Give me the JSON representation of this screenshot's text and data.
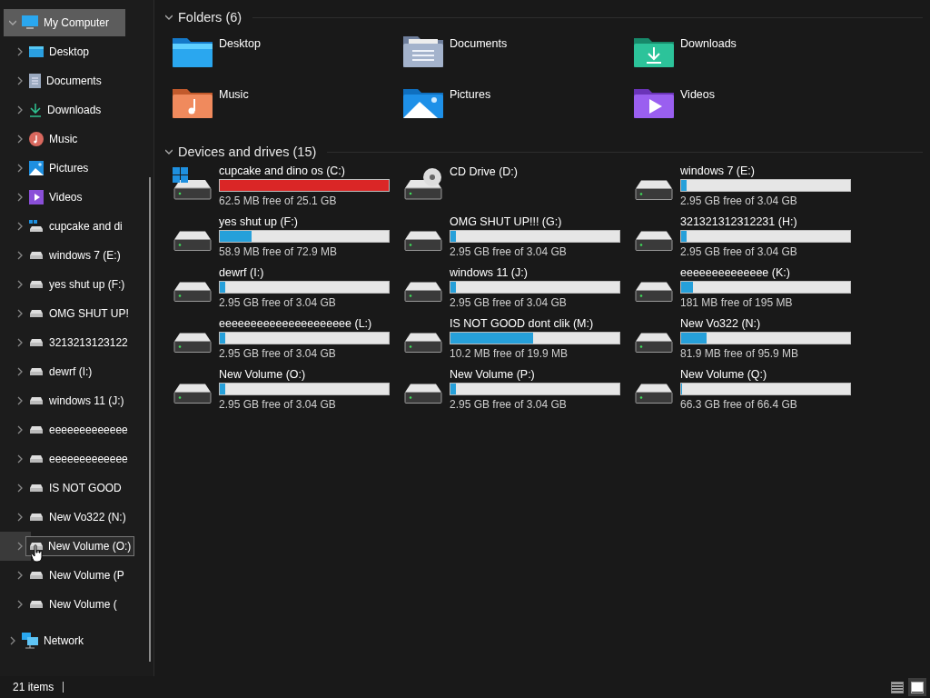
{
  "sidebar": {
    "root": {
      "label": "My Computer",
      "expanded": true,
      "selected": true,
      "children": [
        {
          "label": "Desktop",
          "kind": "desktop",
          "hovered": false
        },
        {
          "label": "Documents",
          "kind": "documents",
          "hovered": false
        },
        {
          "label": "Downloads",
          "kind": "downloads",
          "hovered": false
        },
        {
          "label": "Music",
          "kind": "music",
          "hovered": false
        },
        {
          "label": "Pictures",
          "kind": "pictures",
          "hovered": false
        },
        {
          "label": "Videos",
          "kind": "videos",
          "hovered": false
        },
        {
          "label": "cupcake and di",
          "kind": "system",
          "hovered": false
        },
        {
          "label": "windows 7 (E:)",
          "kind": "drive",
          "hovered": false
        },
        {
          "label": "yes shut up (F:)",
          "kind": "drive",
          "hovered": false
        },
        {
          "label": "OMG SHUT UP!",
          "kind": "drive",
          "hovered": false
        },
        {
          "label": "3213213123122",
          "kind": "drive",
          "hovered": false
        },
        {
          "label": "dewrf (I:)",
          "kind": "drive",
          "hovered": false
        },
        {
          "label": "windows 11 (J:)",
          "kind": "drive",
          "hovered": false
        },
        {
          "label": "eeeeeeeeeeeee",
          "kind": "drive",
          "hovered": false
        },
        {
          "label": "eeeeeeeeeeeee",
          "kind": "drive",
          "hovered": false
        },
        {
          "label": "IS NOT GOOD",
          "kind": "drive",
          "hovered": false
        },
        {
          "label": "New Vo322 (N:)",
          "kind": "drive",
          "hovered": false
        },
        {
          "label": "New Volume (O:)",
          "kind": "drive",
          "hovered": true
        },
        {
          "label": "New Volume (P",
          "kind": "drive",
          "hovered": false
        },
        {
          "label": "New Volume (",
          "kind": "drive",
          "hovered": false
        }
      ]
    },
    "network": {
      "label": "Network",
      "expanded": false
    }
  },
  "sections": [
    {
      "title": "Folders (6)",
      "expanded": true
    },
    {
      "title": "Devices and drives (15)",
      "expanded": true
    }
  ],
  "folders": [
    {
      "label": "Desktop",
      "kind": "desktop"
    },
    {
      "label": "Documents",
      "kind": "documents"
    },
    {
      "label": "Downloads",
      "kind": "downloads"
    },
    {
      "label": "Music",
      "kind": "music"
    },
    {
      "label": "Pictures",
      "kind": "pictures"
    },
    {
      "label": "Videos",
      "kind": "videos"
    }
  ],
  "drives": [
    {
      "name": "cupcake and dino os (C:)",
      "kind": "system",
      "level": 0.998,
      "low_space": true,
      "free": "62.5 MB free of 25.1 GB"
    },
    {
      "name": "CD Drive (D:)",
      "kind": "optical"
    },
    {
      "name": "windows 7 (E:)",
      "kind": "disk",
      "level": 0.03,
      "low_space": false,
      "free": "2.95 GB free of 3.04 GB"
    },
    {
      "name": "yes shut up (F:)",
      "kind": "disk",
      "level": 0.19,
      "low_space": false,
      "free": "58.9 MB free of 72.9 MB"
    },
    {
      "name": "OMG SHUT UP!!! (G:)",
      "kind": "disk",
      "level": 0.03,
      "low_space": false,
      "free": "2.95 GB free of 3.04 GB"
    },
    {
      "name": "321321312312231 (H:)",
      "kind": "disk",
      "level": 0.03,
      "low_space": false,
      "free": "2.95 GB free of 3.04 GB"
    },
    {
      "name": "dewrf (I:)",
      "kind": "disk",
      "level": 0.03,
      "low_space": false,
      "free": "2.95 GB free of 3.04 GB"
    },
    {
      "name": "windows 11 (J:)",
      "kind": "disk",
      "level": 0.03,
      "low_space": false,
      "free": "2.95 GB free of 3.04 GB"
    },
    {
      "name": "eeeeeeeeeeeeee (K:)",
      "kind": "disk",
      "level": 0.07,
      "low_space": false,
      "free": "181 MB free of 195 MB"
    },
    {
      "name": "eeeeeeeeeeeeeeeeeeeee (L:)",
      "kind": "disk",
      "level": 0.03,
      "low_space": false,
      "free": "2.95 GB free of 3.04 GB"
    },
    {
      "name": "IS NOT GOOD dont clik (M:)",
      "kind": "disk",
      "level": 0.49,
      "low_space": false,
      "free": "10.2 MB free of 19.9 MB"
    },
    {
      "name": "New Vo322 (N:)",
      "kind": "disk",
      "level": 0.15,
      "low_space": false,
      "free": "81.9 MB free of 95.9 MB"
    },
    {
      "name": "New Volume (O:)",
      "kind": "disk",
      "level": 0.03,
      "low_space": false,
      "free": "2.95 GB free of 3.04 GB"
    },
    {
      "name": "New Volume (P:)",
      "kind": "disk",
      "level": 0.03,
      "low_space": false,
      "free": "2.95 GB free of 3.04 GB"
    },
    {
      "name": "New Volume (Q:)",
      "kind": "disk",
      "level": 0.002,
      "low_space": false,
      "free": "66.3 GB free of 66.4 GB"
    }
  ],
  "status_bar": {
    "count": "21 items",
    "views": [
      {
        "kind": "details",
        "selected": false
      },
      {
        "kind": "tiles",
        "selected": true
      }
    ]
  }
}
